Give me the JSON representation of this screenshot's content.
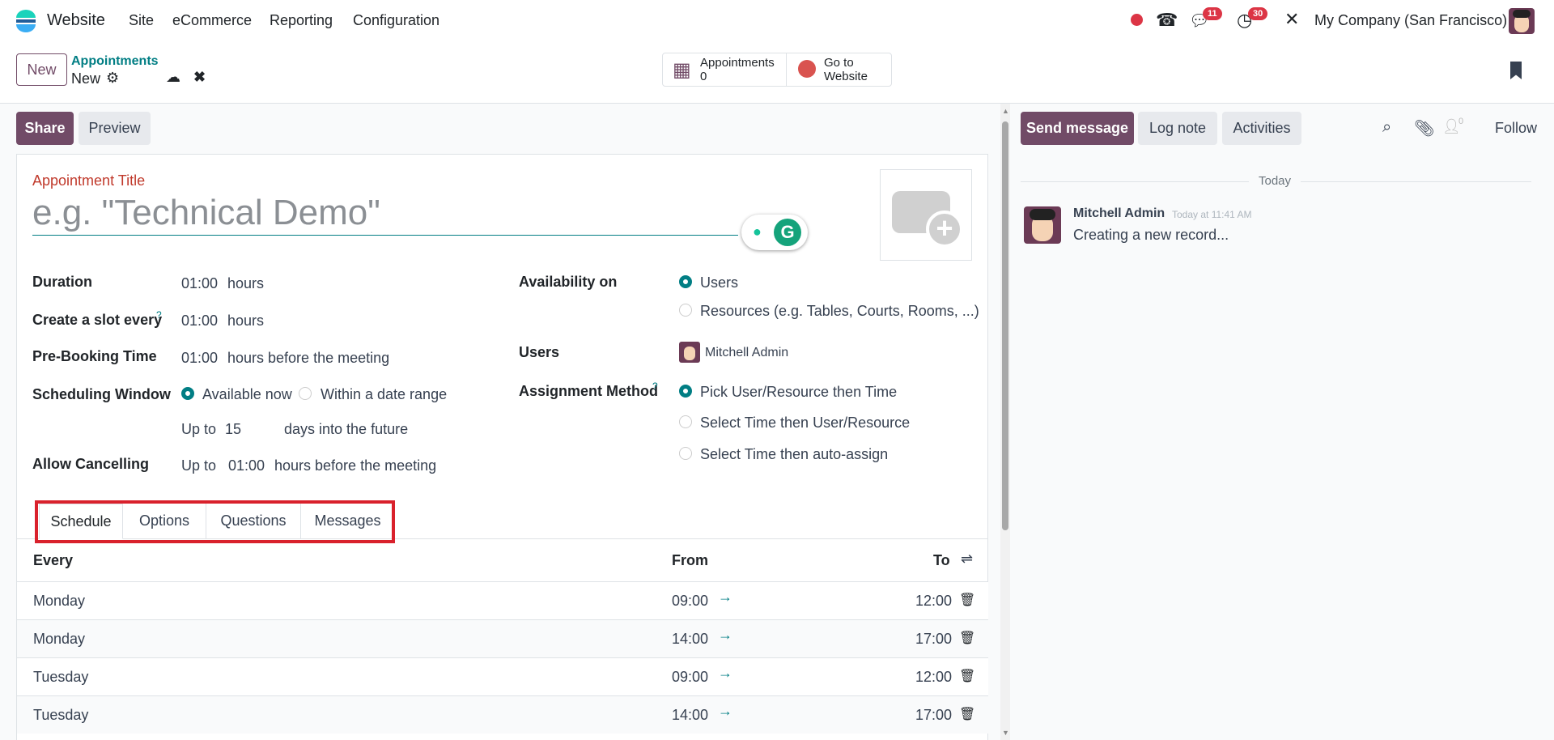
{
  "navbar": {
    "app_name": "Website",
    "menu": [
      "Site",
      "eCommerce",
      "Reporting",
      "Configuration"
    ],
    "messages_count": "11",
    "activities_count": "30",
    "company": "My Company (San Francisco)"
  },
  "control_panel": {
    "new_label": "New",
    "breadcrumb_parent": "Appointments",
    "breadcrumb_current": "New",
    "smart_buttons": [
      {
        "label": "Appointments",
        "value": "0"
      },
      {
        "label": "Go to",
        "label2": "Website"
      }
    ]
  },
  "actions": {
    "share": "Share",
    "preview": "Preview"
  },
  "form": {
    "title_label": "Appointment Title",
    "title_placeholder": "e.g. \"Technical Demo\"",
    "duration_label": "Duration",
    "duration_value": "01:00",
    "hours": "hours",
    "slot_label": "Create a slot every",
    "slot_value": "01:00",
    "prebooking_label": "Pre-Booking Time",
    "prebooking_value": "01:00",
    "before_meeting": "hours before the meeting",
    "window_label": "Scheduling Window",
    "window_option1": "Available now",
    "window_option2": "Within a date range",
    "up_to": "Up to",
    "days_value": "15",
    "days_suffix": "days into the future",
    "cancel_label": "Allow Cancelling",
    "cancel_value": "01:00",
    "availability_label": "Availability on",
    "availability_option1": "Users",
    "availability_option2": "Resources (e.g. Tables, Courts, Rooms, ...)",
    "users_label": "Users",
    "users_value": "Mitchell Admin",
    "assignment_label": "Assignment Method",
    "assignment_options": [
      "Pick User/Resource then Time",
      "Select Time then User/Resource",
      "Select Time then auto-assign"
    ],
    "help_mark": "?"
  },
  "tabs": [
    "Schedule",
    "Options",
    "Questions",
    "Messages"
  ],
  "schedule": {
    "headers": {
      "every": "Every",
      "from": "From",
      "to": "To"
    },
    "rows": [
      {
        "day": "Monday",
        "from": "09:00",
        "to": "12:00"
      },
      {
        "day": "Monday",
        "from": "14:00",
        "to": "17:00"
      },
      {
        "day": "Tuesday",
        "from": "09:00",
        "to": "12:00"
      },
      {
        "day": "Tuesday",
        "from": "14:00",
        "to": "17:00"
      }
    ]
  },
  "chatter": {
    "send_message": "Send message",
    "log_note": "Log note",
    "activities": "Activities",
    "followers_count": "0",
    "follow": "Follow",
    "date_separator": "Today",
    "message": {
      "author": "Mitchell Admin",
      "time": "Today at 11:41 AM",
      "body": "Creating a new record..."
    }
  },
  "colors": {
    "primary": "#714b67",
    "accent": "#017e84",
    "highlight": "#d9212c"
  }
}
